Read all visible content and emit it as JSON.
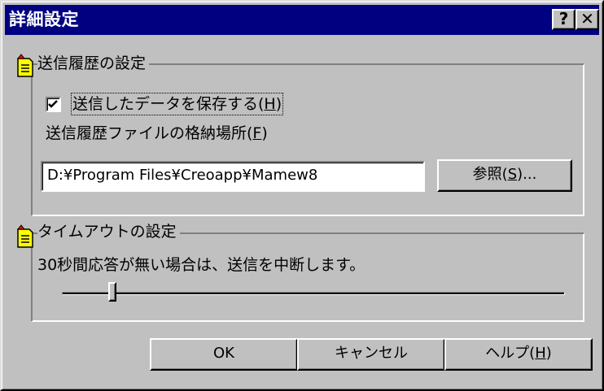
{
  "window": {
    "title": "詳細設定",
    "help_glyph": "?",
    "close_glyph": "✕"
  },
  "history_group": {
    "legend": "送信履歴の設定",
    "icon": "note-icon",
    "save_checkbox": {
      "label_before": "送信したデータを保存する(",
      "accelerator": "H",
      "label_after": ")",
      "checked": true
    },
    "location_label_before": "送信履歴ファイルの格納場所(",
    "location_accelerator": "F",
    "location_label_after": ")",
    "path_value": "D:¥Program Files¥Creoapp¥Mamew8",
    "browse_button": {
      "label_before": "参照(",
      "accelerator": "S",
      "label_after": ")..."
    }
  },
  "timeout_group": {
    "legend": "タイムアウトの設定",
    "icon": "note-icon",
    "description": "30秒間応答が無い場合は、送信を中断します。",
    "slider": {
      "value_fraction": 0.1
    }
  },
  "footer": {
    "ok_label": "OK",
    "cancel_label": "キャンセル",
    "help_label_before": "ヘルプ(",
    "help_accelerator": "H",
    "help_label_after": ")"
  },
  "colors": {
    "titlebar": "#000080",
    "face": "#c0c0c0"
  }
}
